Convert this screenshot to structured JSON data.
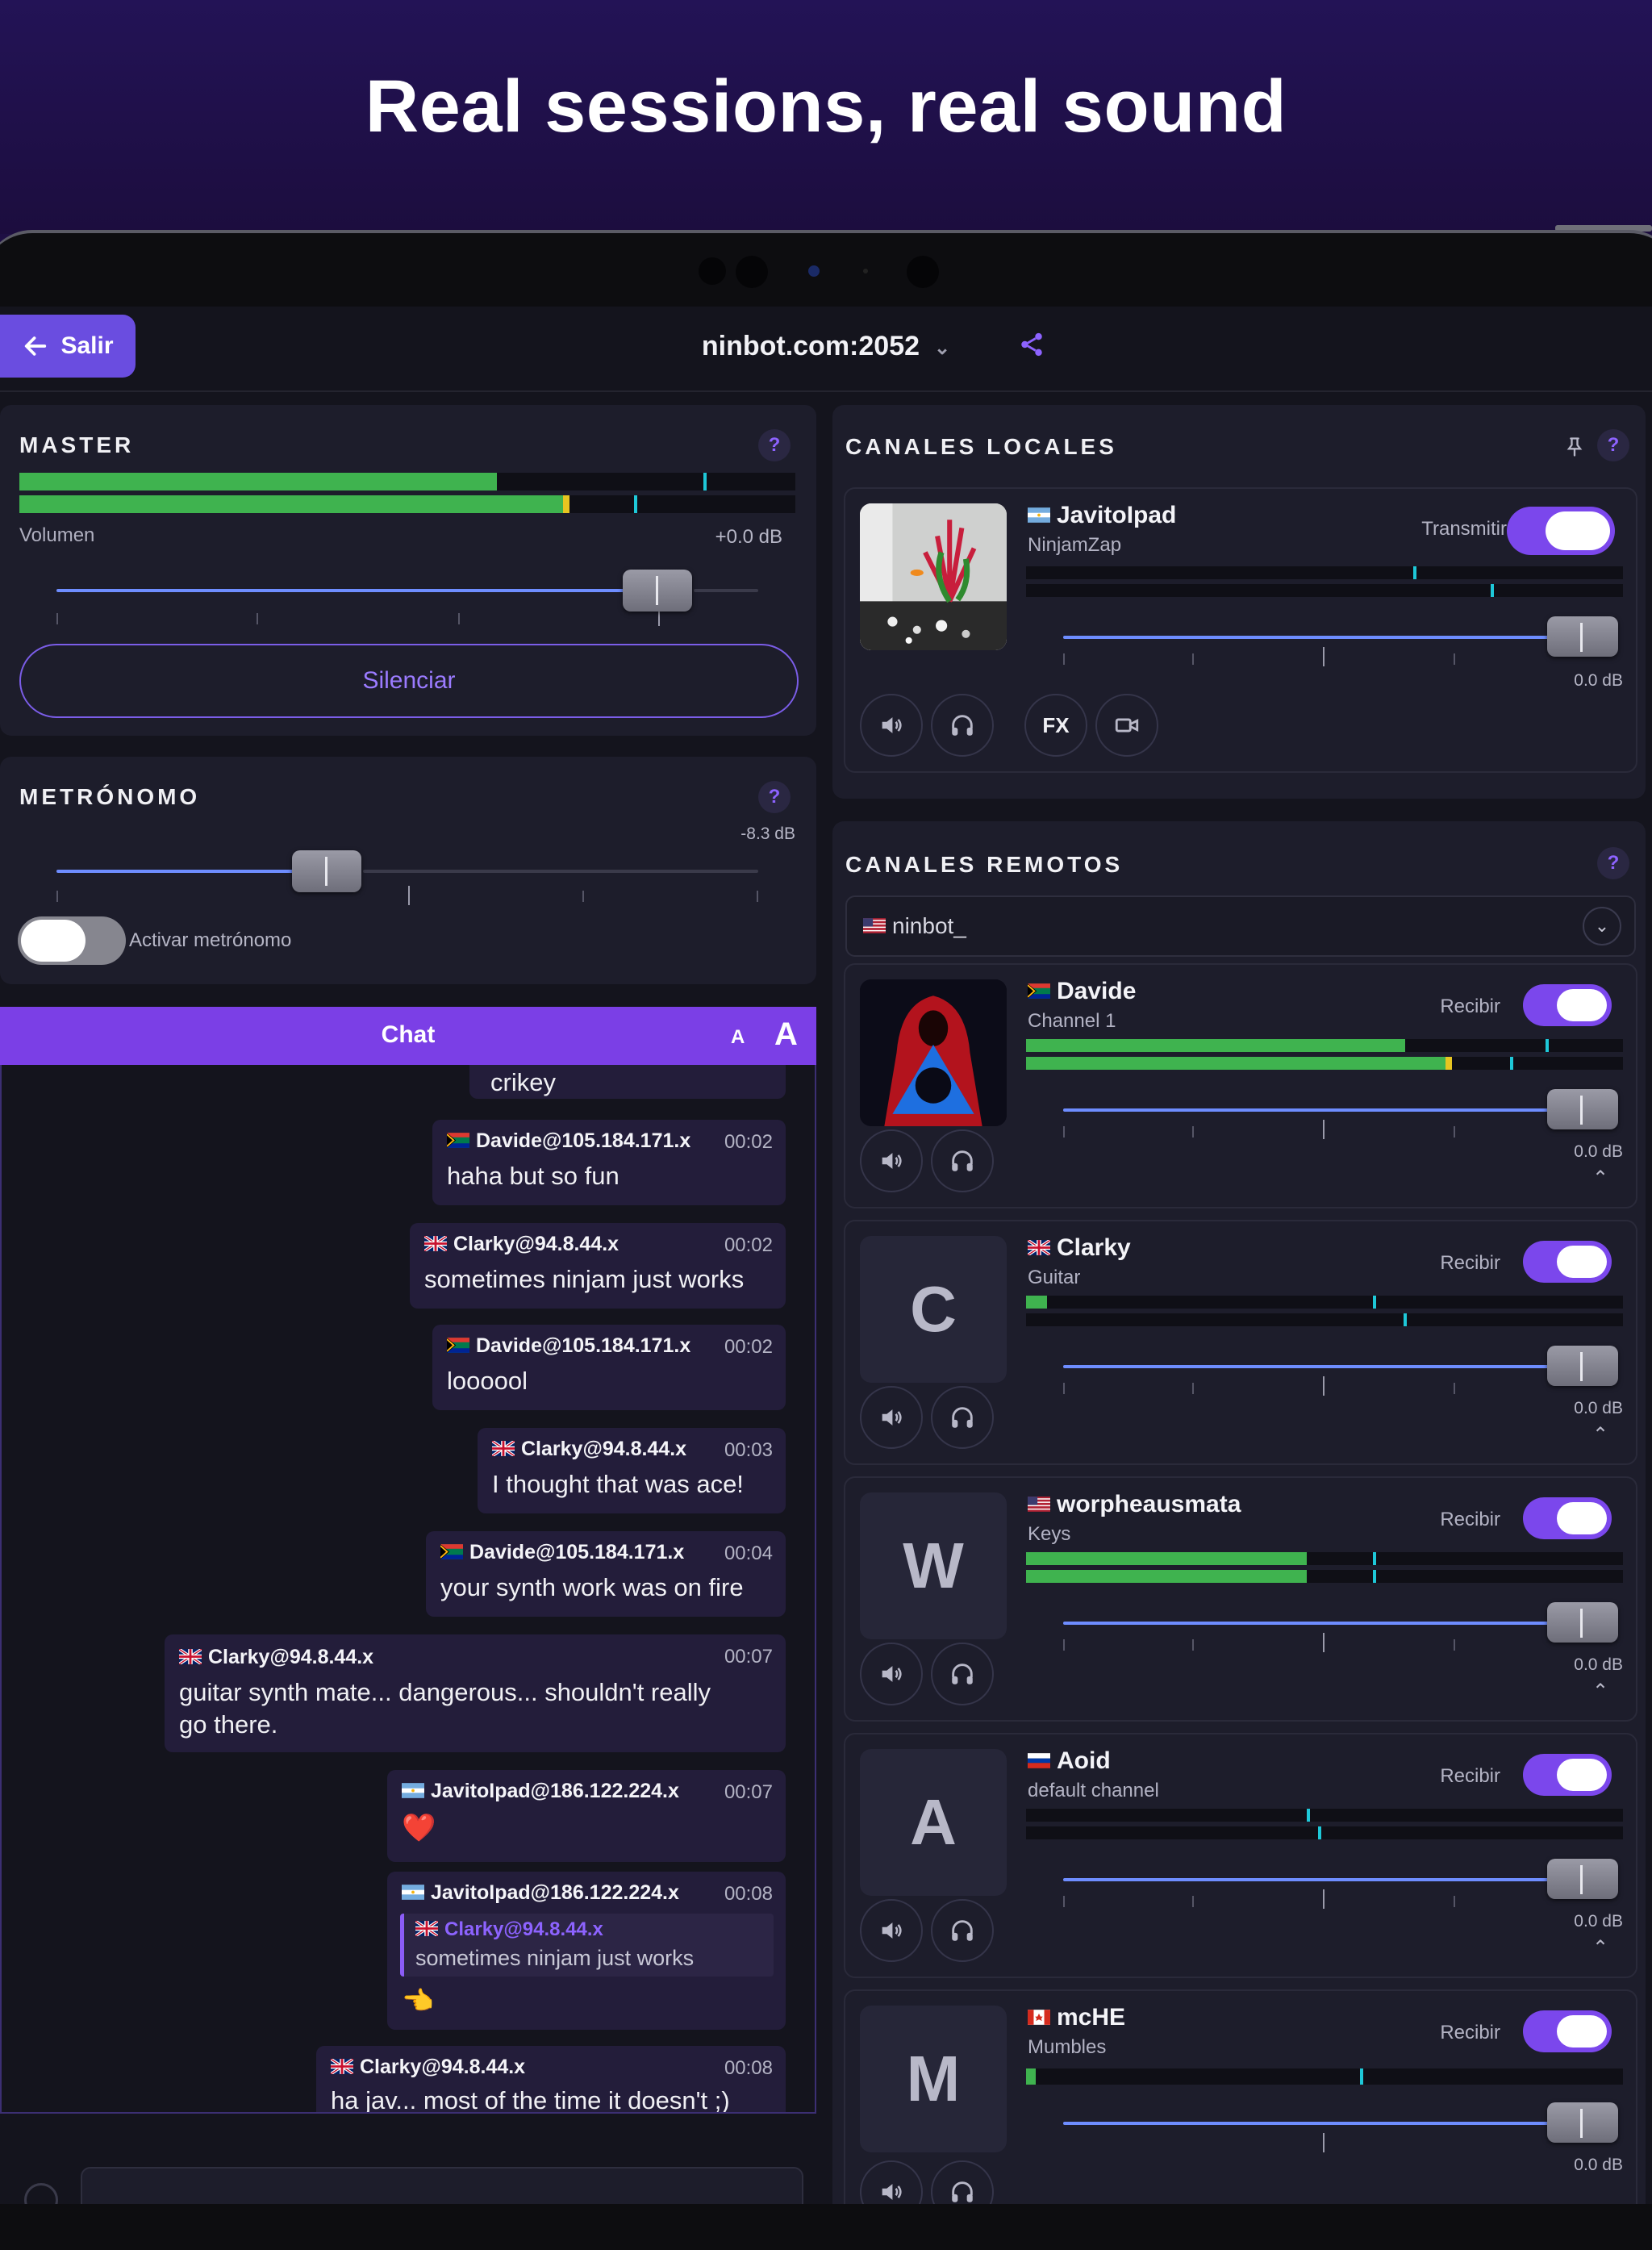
{
  "hero": {
    "title": "Real sessions, real sound"
  },
  "topbar": {
    "back_label": "Salir",
    "server": "ninbot.com:2052"
  },
  "master": {
    "title": "MASTER",
    "help": "?",
    "volume_label": "Volumen",
    "volume_db": "+0.0 dB",
    "mute_label": "Silenciar",
    "meter_levels": [
      0.61,
      0.7
    ],
    "slider_value": 0.86
  },
  "metronome": {
    "title": "METRÓNOMO",
    "help": "?",
    "db": "-8.3 dB",
    "toggle_label": "Activar metrónomo",
    "enabled": false,
    "slider_value": 0.38
  },
  "chat": {
    "title": "Chat",
    "font_small": "A",
    "font_large": "A",
    "messages": [
      {
        "text": "crikey"
      },
      {
        "flag": "za",
        "user": "Davide@105.184.171.x",
        "time": "00:02",
        "text": "haha but so fun"
      },
      {
        "flag": "uk",
        "user": "Clarky@94.8.44.x",
        "time": "00:02",
        "text": "sometimes ninjam just works"
      },
      {
        "flag": "za",
        "user": "Davide@105.184.171.x",
        "time": "00:02",
        "text": "loooool"
      },
      {
        "flag": "uk",
        "user": "Clarky@94.8.44.x",
        "time": "00:03",
        "text": "I thought that was ace!"
      },
      {
        "flag": "za",
        "user": "Davide@105.184.171.x",
        "time": "00:04",
        "text": "your synth work was on fire"
      },
      {
        "flag": "uk",
        "user": "Clarky@94.8.44.x",
        "time": "00:07",
        "text": "guitar synth mate... dangerous... shouldn't really",
        "text2": "go there."
      },
      {
        "flag": "ar",
        "user": "JavitoIpad@186.122.224.x",
        "time": "00:07",
        "text": "❤️"
      },
      {
        "flag": "ar",
        "user": "JavitoIpad@186.122.224.x",
        "time": "00:08",
        "quote_user": "Clarky@94.8.44.x",
        "quote_text": "sometimes ninjam just works",
        "text": "👈"
      },
      {
        "flag": "uk",
        "user": "Clarky@94.8.44.x",
        "time": "00:08",
        "text": "ha jav... most of the time it doesn't ;)"
      }
    ]
  },
  "local": {
    "title": "CANALES LOCALES",
    "help": "?",
    "pin_icon": "pin-icon",
    "channel": {
      "flag": "ar",
      "name": "JavitoIpad",
      "sub": "NinjamZap",
      "transmit_label": "Transmitir",
      "transmitting": true,
      "db": "0.0 dB",
      "fx_label": "FX"
    }
  },
  "remote": {
    "title": "CANALES REMOTOS",
    "help": "?",
    "user_select": {
      "flag": "us",
      "name": "ninbot_"
    },
    "channels": [
      {
        "flag": "za",
        "name": "Davide",
        "sub": "Channel 1",
        "initial": "",
        "receive_label": "Recibir",
        "receiving": true,
        "db": "0.0 dB",
        "levels": [
          0.63,
          0.7
        ]
      },
      {
        "flag": "uk",
        "name": "Clarky",
        "sub": "Guitar",
        "initial": "C",
        "receive_label": "Recibir",
        "receiving": true,
        "db": "0.0 dB",
        "levels": [
          0.035,
          0.0
        ]
      },
      {
        "flag": "us",
        "name": "worpheausmata",
        "sub": "Keys",
        "initial": "W",
        "receive_label": "Recibir",
        "receiving": true,
        "db": "0.0 dB",
        "levels": [
          0.47,
          0.47
        ]
      },
      {
        "flag": "ru",
        "name": "Aoid",
        "sub": "default channel",
        "initial": "A",
        "receive_label": "Recibir",
        "receiving": true,
        "db": "0.0 dB",
        "levels": [
          0.0,
          0.0
        ]
      },
      {
        "flag": "ca",
        "name": "mcHE",
        "sub": "Mumbles",
        "initial": "M",
        "receive_label": "Recibir",
        "receiving": true,
        "db": "0.0 dB",
        "levels": [
          0.02
        ]
      }
    ]
  },
  "colors": {
    "accent": "#7b47ec",
    "meter": "#3fb34f",
    "peak": "#e7c521",
    "marker": "#1ec8d8",
    "panel": "#1d1d2b"
  }
}
